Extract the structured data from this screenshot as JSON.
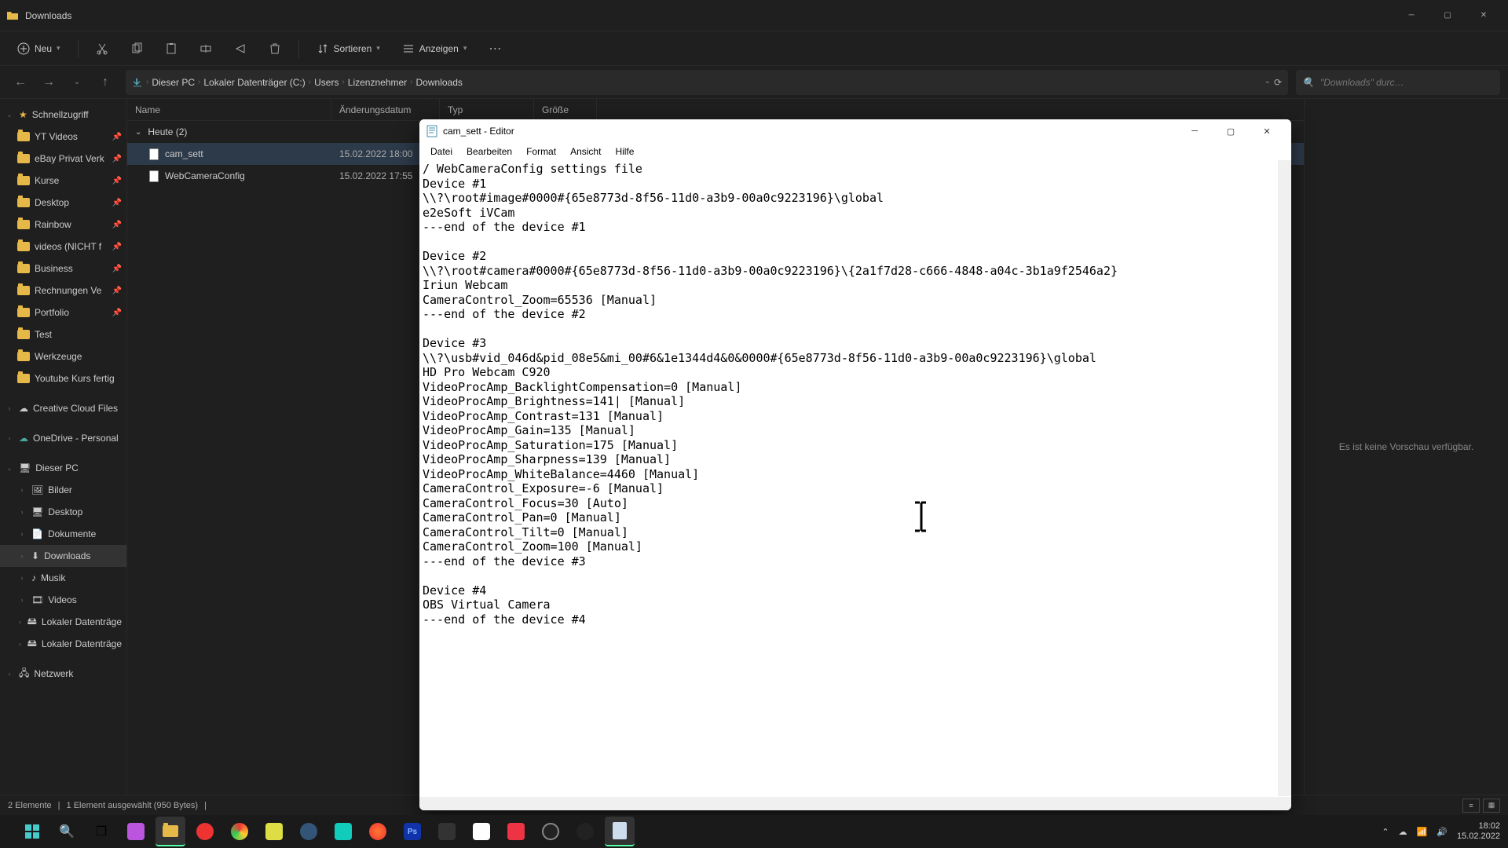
{
  "explorer": {
    "title": "Downloads",
    "toolbar": {
      "new": "Neu",
      "sort": "Sortieren",
      "view": "Anzeigen"
    },
    "breadcrumbs": [
      "Dieser PC",
      "Lokaler Datenträger (C:)",
      "Users",
      "Lizenznehmer",
      "Downloads"
    ],
    "search_placeholder": "\"Downloads\" durc…",
    "columns": {
      "name": "Name",
      "date": "Änderungsdatum",
      "type": "Typ",
      "size": "Größe"
    },
    "group_label": "Heute (2)",
    "files": [
      {
        "name": "cam_sett",
        "date": "15.02.2022 18:00"
      },
      {
        "name": "WebCameraConfig",
        "date": "15.02.2022 17:55"
      }
    ],
    "preview_msg": "Es ist keine Vorschau verfügbar.",
    "status": {
      "items": "2 Elemente",
      "selected": "1 Element ausgewählt (950 Bytes)"
    },
    "sidebar": {
      "quick": "Schnellzugriff",
      "quick_items": [
        "YT Videos",
        "eBay Privat Verk",
        "Kurse",
        "Desktop",
        "Rainbow",
        "videos (NICHT f",
        "Business",
        "Rechnungen Ve",
        "Portfolio",
        "Test",
        "Werkzeuge",
        "Youtube Kurs fertig"
      ],
      "creative": "Creative Cloud Files",
      "onedrive": "OneDrive - Personal",
      "thispc": "Dieser PC",
      "pc_items": [
        "Bilder",
        "Desktop",
        "Dokumente",
        "Downloads",
        "Musik",
        "Videos",
        "Lokaler Datenträge",
        "Lokaler Datenträge"
      ],
      "network": "Netzwerk"
    }
  },
  "notepad": {
    "title": "cam_sett - Editor",
    "menu": [
      "Datei",
      "Bearbeiten",
      "Format",
      "Ansicht",
      "Hilfe"
    ],
    "content": "/ WebCameraConfig settings file\nDevice #1\n\\\\?\\root#image#0000#{65e8773d-8f56-11d0-a3b9-00a0c9223196}\\global\ne2eSoft iVCam\n---end of the device #1\n\nDevice #2\n\\\\?\\root#camera#0000#{65e8773d-8f56-11d0-a3b9-00a0c9223196}\\{2a1f7d28-c666-4848-a04c-3b1a9f2546a2}\nIriun Webcam\nCameraControl_Zoom=65536 [Manual]\n---end of the device #2\n\nDevice #3\n\\\\?\\usb#vid_046d&pid_08e5&mi_00#6&1e1344d4&0&0000#{65e8773d-8f56-11d0-a3b9-00a0c9223196}\\global\nHD Pro Webcam C920\nVideoProcAmp_BacklightCompensation=0 [Manual]\nVideoProcAmp_Brightness=141| [Manual]\nVideoProcAmp_Contrast=131 [Manual]\nVideoProcAmp_Gain=135 [Manual]\nVideoProcAmp_Saturation=175 [Manual]\nVideoProcAmp_Sharpness=139 [Manual]\nVideoProcAmp_WhiteBalance=4460 [Manual]\nCameraControl_Exposure=-6 [Manual]\nCameraControl_Focus=30 [Auto]\nCameraControl_Pan=0 [Manual]\nCameraControl_Tilt=0 [Manual]\nCameraControl_Zoom=100 [Manual]\n---end of the device #3\n\nDevice #4\nOBS Virtual Camera\n---end of the device #4"
  },
  "taskbar": {
    "time": "18:02",
    "date": "15.02.2022"
  }
}
